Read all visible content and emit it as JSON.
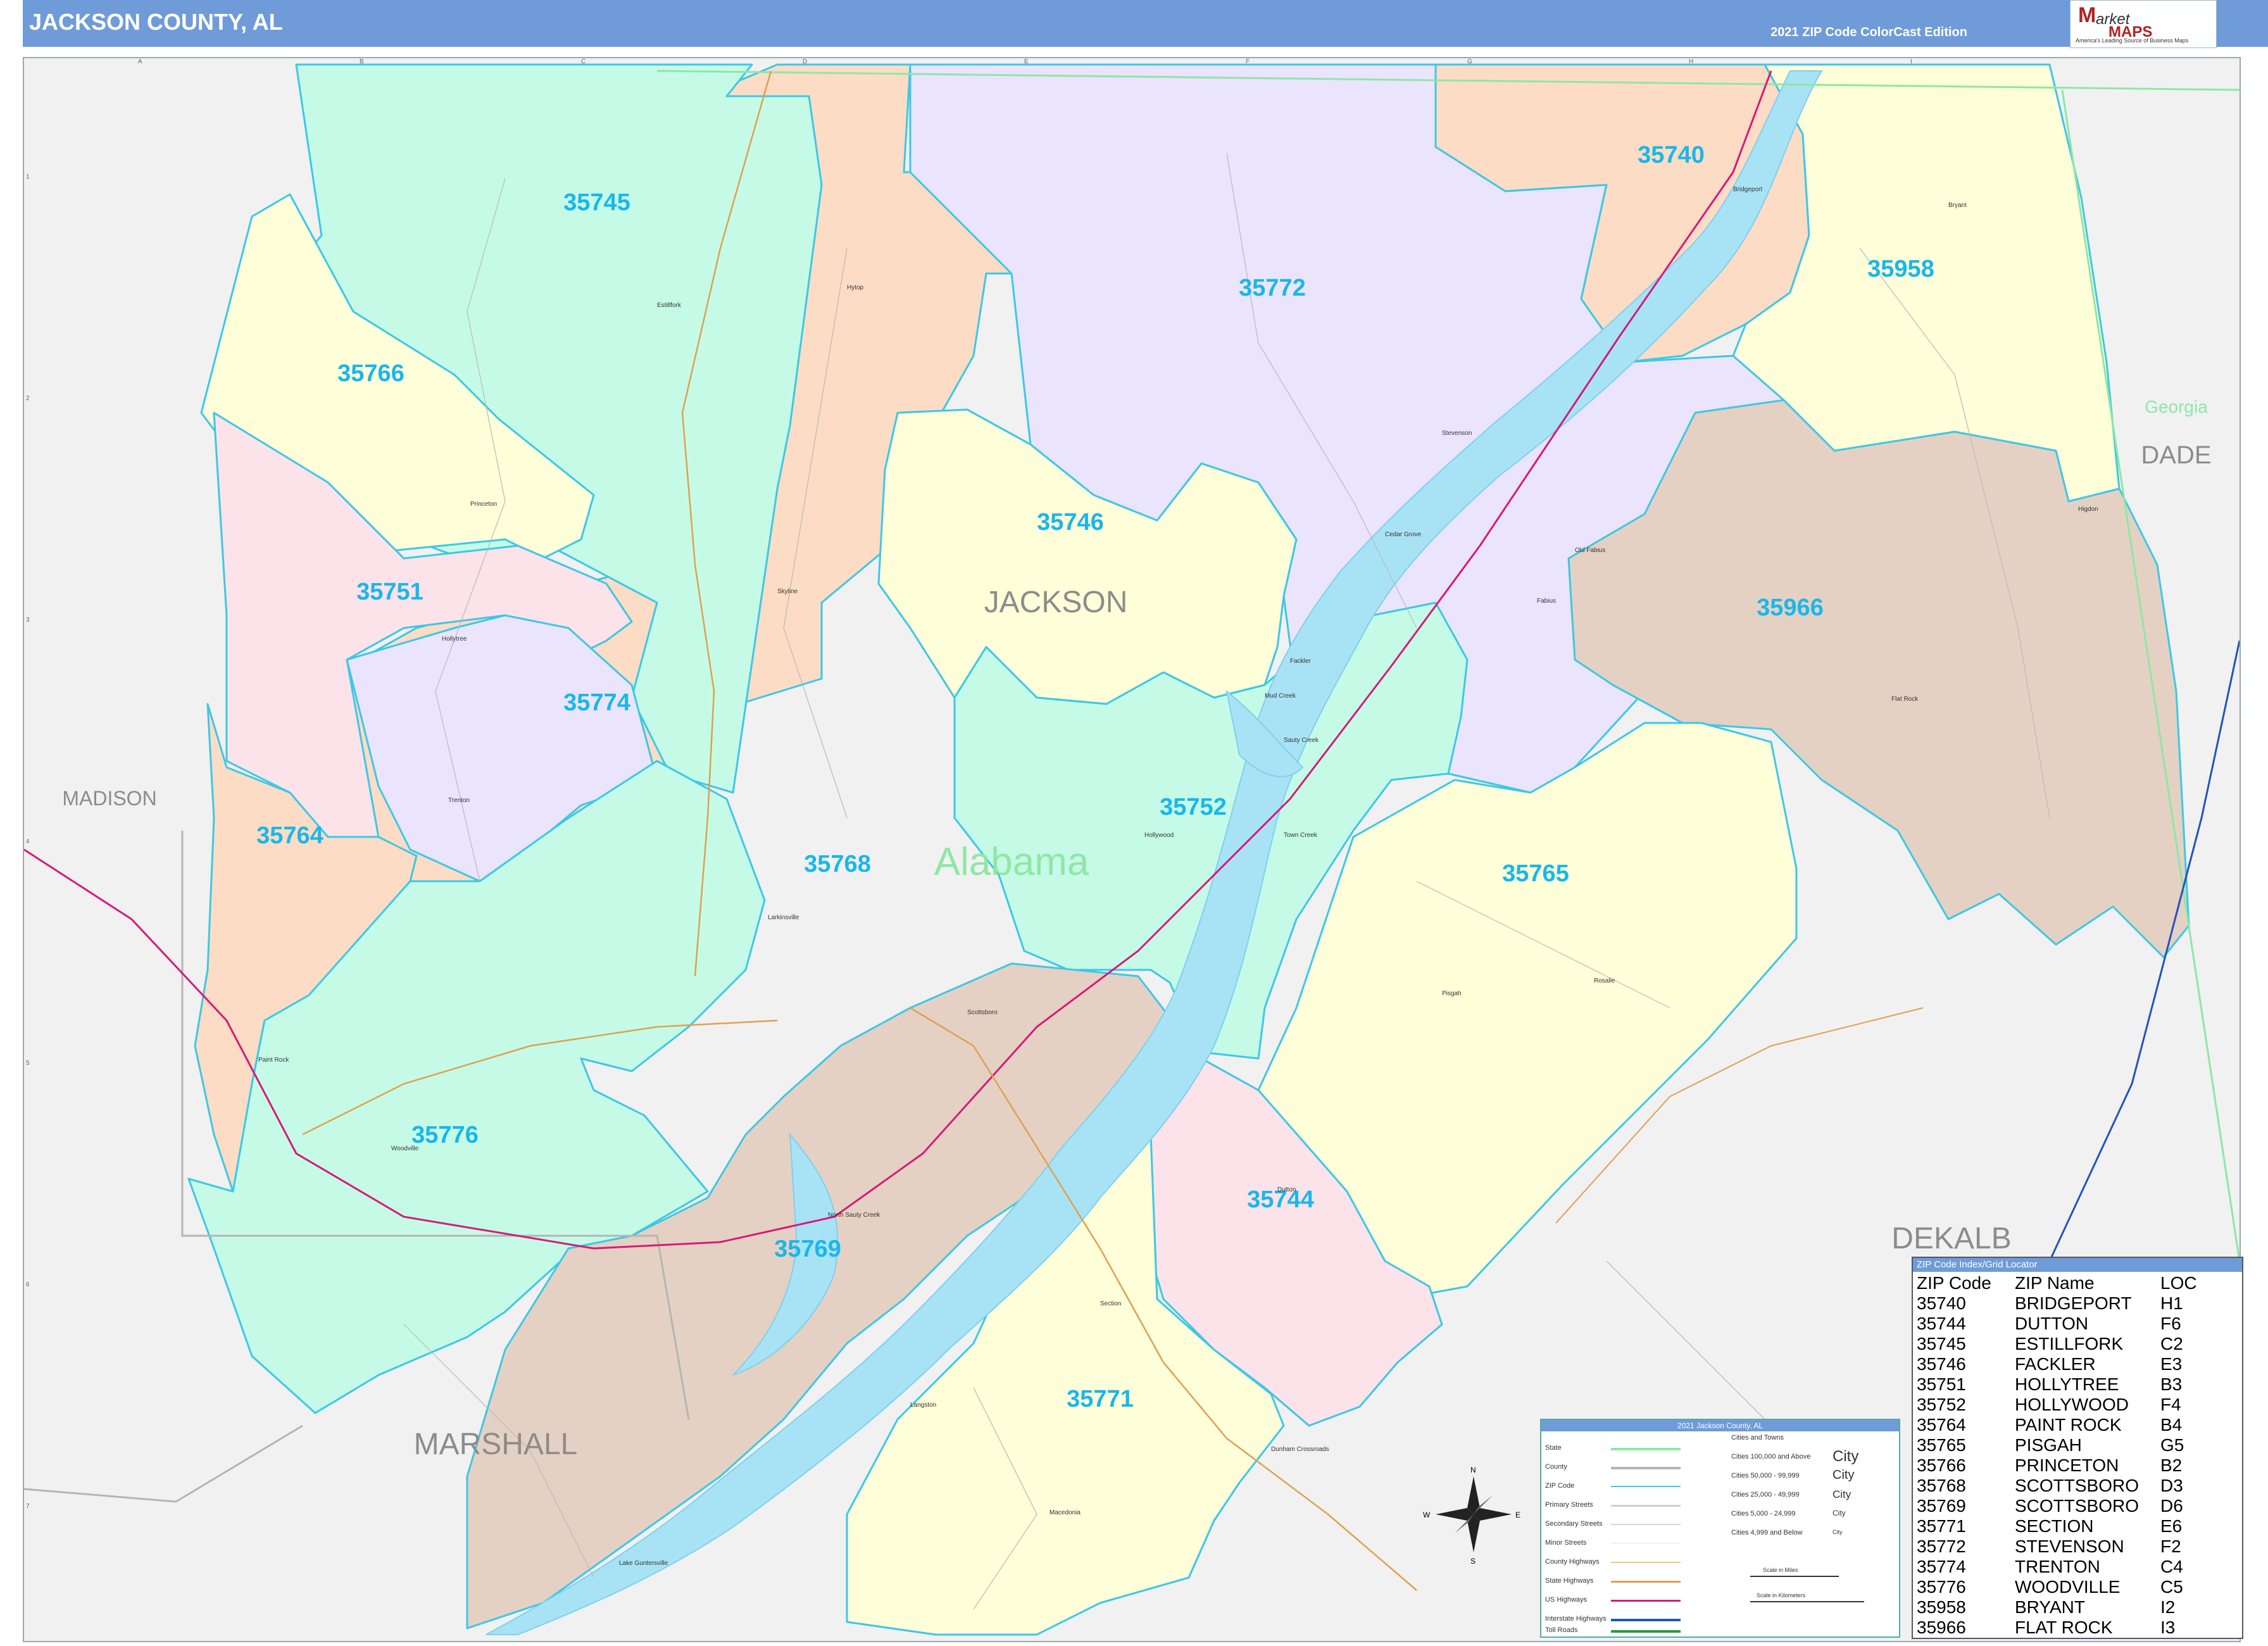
{
  "header": {
    "title": "JACKSON COUNTY, AL",
    "edition": "2021 ZIP Code ColorCast Edition"
  },
  "logo": {
    "brand_m": "M",
    "brand_arket": "arket",
    "brand_maps": "MAPS",
    "tagline": "America's Leading Source of Business Maps"
  },
  "colors": {
    "header_bg": "#6f9bd8",
    "zip_label": "#19b7ea",
    "zip_boundary": "#3cc8e6",
    "water": "#a8e3f5",
    "interstate": "#d61a7a",
    "us_highway": "#d61a7a",
    "state_highway": "#e0a050"
  },
  "map": {
    "zip_areas": [
      {
        "zip": "35745",
        "fill": "#c5fbe6"
      },
      {
        "zip": "35766",
        "fill": "#fefed9"
      },
      {
        "zip": "35751",
        "fill": "#fce2e9"
      },
      {
        "zip": "35774",
        "fill": "#ebe4fd"
      },
      {
        "zip": "35764",
        "fill": "#fcdcc4"
      },
      {
        "zip": "35776",
        "fill": "#c5fbe6"
      },
      {
        "zip": "35768",
        "fill": "#fcdcc4"
      },
      {
        "zip": "35746",
        "fill": "#fefed9"
      },
      {
        "zip": "35772",
        "fill": "#ebe4fd"
      },
      {
        "zip": "35740",
        "fill": "#fcdcc4"
      },
      {
        "zip": "35958",
        "fill": "#fefed9"
      },
      {
        "zip": "35966",
        "fill": "#e5d1c3"
      },
      {
        "zip": "35752",
        "fill": "#c5fbe6"
      },
      {
        "zip": "35765",
        "fill": "#fefed9"
      },
      {
        "zip": "35769",
        "fill": "#e5d1c3"
      },
      {
        "zip": "35744",
        "fill": "#fce2e9"
      },
      {
        "zip": "35771",
        "fill": "#fefed9"
      }
    ],
    "county_labels": [
      "JACKSON",
      "MADISON",
      "MARSHALL",
      "DEKALB",
      "DADE"
    ],
    "state_labels": [
      "Alabama",
      "Georgia"
    ],
    "towns": [
      "Estillfork",
      "Princeton",
      "Hytop",
      "Skyline",
      "Hollytree",
      "Trenton",
      "Larkinsville",
      "Scottsboro",
      "Woodville",
      "Paint Rock",
      "Bridgeport",
      "Stevenson",
      "Bryant",
      "Cedar Grove",
      "Fackler",
      "Hollywood",
      "Old Fabius",
      "Fabius",
      "Flat Rock",
      "Pisgah",
      "Dutton",
      "Section",
      "Langston",
      "Macedonia",
      "Dunham Crossroads",
      "Higdon",
      "Rosalie",
      "Sauty Creek",
      "Mud Creek",
      "Town Creek",
      "Lake Guntersville",
      "North Sauty Creek"
    ],
    "grid_columns": [
      "A",
      "B",
      "C",
      "D",
      "E",
      "F",
      "G",
      "H",
      "I"
    ],
    "grid_rows": [
      "1",
      "2",
      "3",
      "4",
      "5",
      "6",
      "7"
    ],
    "compass": [
      "N",
      "E",
      "S",
      "W"
    ]
  },
  "legend": {
    "title": "2021 Jackson County, AL",
    "lines": [
      "State",
      "County",
      "ZIP Code",
      "Primary Streets",
      "Secondary Streets",
      "Minor Streets",
      "County Highways",
      "State Highways",
      "US Highways",
      "Interstate Highways",
      "Toll Roads"
    ],
    "cities_header": "Cities and Towns",
    "city_sizes": [
      "Cities 100,000 and Above",
      "Cities 50,000 - 99,999",
      "Cities 25,000 - 49,999",
      "Cities 5,000 - 24,999",
      "Cities 4,999 and Below"
    ],
    "city_samples": [
      "City",
      "City",
      "City",
      "City",
      "City"
    ],
    "scale_miles": "Scale in Miles",
    "scale_km": "Scale in Kilometers"
  },
  "zip_index": {
    "title": "ZIP Code Index/Grid Locator",
    "headers": [
      "ZIP Code",
      "ZIP Name",
      "LOC"
    ],
    "rows": [
      [
        "35740",
        "BRIDGEPORT",
        "H1"
      ],
      [
        "35744",
        "DUTTON",
        "F6"
      ],
      [
        "35745",
        "ESTILLFORK",
        "C2"
      ],
      [
        "35746",
        "FACKLER",
        "E3"
      ],
      [
        "35751",
        "HOLLYTREE",
        "B3"
      ],
      [
        "35752",
        "HOLLYWOOD",
        "F4"
      ],
      [
        "35764",
        "PAINT ROCK",
        "B4"
      ],
      [
        "35765",
        "PISGAH",
        "G5"
      ],
      [
        "35766",
        "PRINCETON",
        "B2"
      ],
      [
        "35768",
        "SCOTTSBORO",
        "D3"
      ],
      [
        "35769",
        "SCOTTSBORO",
        "D6"
      ],
      [
        "35771",
        "SECTION",
        "E6"
      ],
      [
        "35772",
        "STEVENSON",
        "F2"
      ],
      [
        "35774",
        "TRENTON",
        "C4"
      ],
      [
        "35776",
        "WOODVILLE",
        "C5"
      ],
      [
        "35958",
        "BRYANT",
        "I2"
      ],
      [
        "35966",
        "FLAT ROCK",
        "I3"
      ]
    ]
  }
}
